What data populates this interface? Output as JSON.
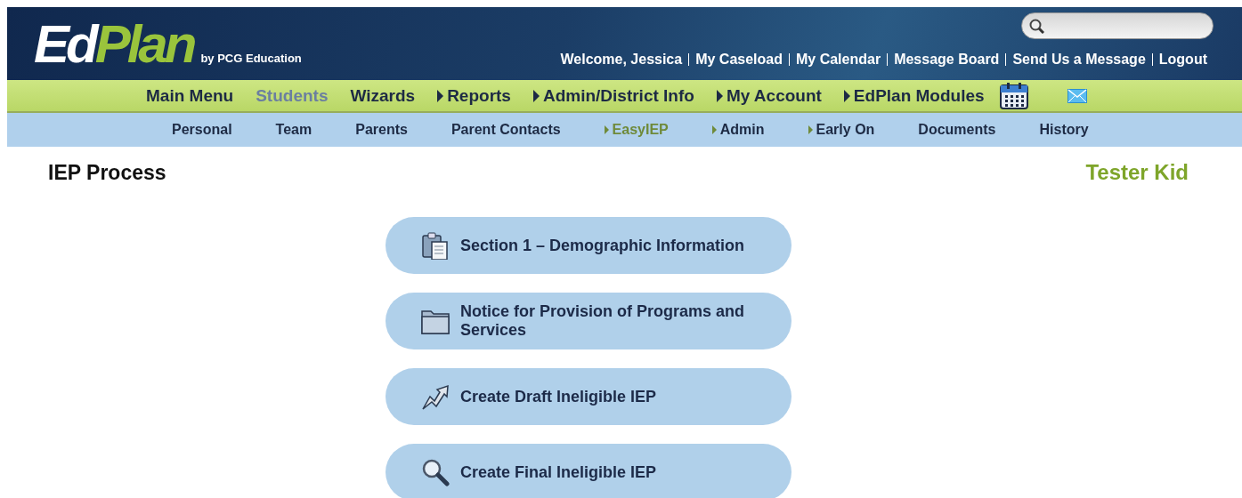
{
  "logo": {
    "text": "Ed",
    "accent": "Plan",
    "tagline": "by PCG Education"
  },
  "user_links": [
    "Welcome, Jessica",
    "My Caseload",
    "My Calendar",
    "Message Board",
    "Send Us a Message",
    "Logout"
  ],
  "main_menu": [
    {
      "label": "Main Menu",
      "kind": "link",
      "selected": false
    },
    {
      "label": "Students",
      "kind": "link",
      "selected": true
    },
    {
      "label": "Wizards",
      "kind": "link",
      "selected": false
    },
    {
      "label": "Reports",
      "kind": "submenu",
      "selected": false
    },
    {
      "label": "Admin/District Info",
      "kind": "submenu",
      "selected": false
    },
    {
      "label": "My Account",
      "kind": "submenu",
      "selected": false
    },
    {
      "label": "EdPlan Modules",
      "kind": "submenu",
      "selected": false
    }
  ],
  "sub_menu": [
    {
      "label": "Personal",
      "kind": "link",
      "selected": false
    },
    {
      "label": "Team",
      "kind": "link",
      "selected": false
    },
    {
      "label": "Parents",
      "kind": "link",
      "selected": false
    },
    {
      "label": "Parent Contacts",
      "kind": "link",
      "selected": false
    },
    {
      "label": "EasyIEP",
      "kind": "submenu",
      "selected": true
    },
    {
      "label": "Admin",
      "kind": "submenu",
      "selected": false
    },
    {
      "label": "Early On",
      "kind": "submenu",
      "selected": false
    },
    {
      "label": "Documents",
      "kind": "link",
      "selected": false
    },
    {
      "label": "History",
      "kind": "link",
      "selected": false
    }
  ],
  "page": {
    "title": "IEP Process",
    "student": "Tester Kid"
  },
  "actions": [
    {
      "label": "Section 1 – Demographic Information",
      "kind": "clipboard"
    },
    {
      "label": "Notice for Provision of Programs and Services",
      "kind": "folder"
    },
    {
      "label": "Create Draft Ineligible IEP",
      "kind": "arrow"
    },
    {
      "label": "Create Final Ineligible IEP",
      "kind": "search"
    }
  ]
}
